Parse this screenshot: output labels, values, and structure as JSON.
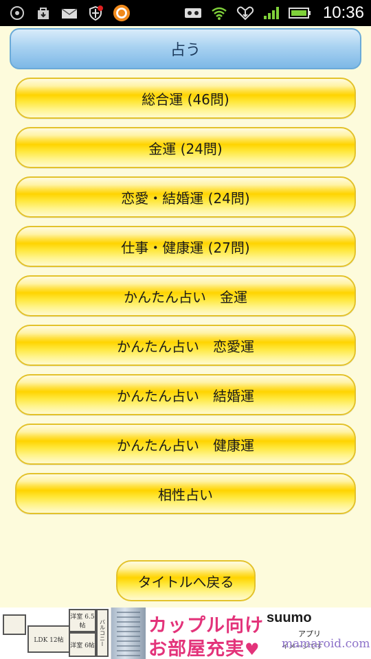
{
  "status_bar": {
    "time": "10:36",
    "left_icons": [
      "aperture-icon",
      "shopping-bag-icon",
      "mail-icon",
      "shield-icon",
      "app-ring-icon"
    ],
    "right_icons": [
      "voicemail-icon",
      "wifi-icon",
      "heart-download-icon",
      "signal-icon",
      "battery-icon"
    ]
  },
  "header": {
    "title": "占う"
  },
  "menu": {
    "items": [
      {
        "label": "総合運 (46問)"
      },
      {
        "label": "金運 (24問)"
      },
      {
        "label": "恋愛・結婚運 (24問)"
      },
      {
        "label": "仕事・健康運 (27問)"
      },
      {
        "label": "かんたん占い　金運"
      },
      {
        "label": "かんたん占い　恋愛運"
      },
      {
        "label": "かんたん占い　結婚運"
      },
      {
        "label": "かんたん占い　健康運"
      },
      {
        "label": "相性占い"
      }
    ]
  },
  "back_button": {
    "label": "タイトルへ戻る"
  },
  "ad": {
    "line1": "カップル向け",
    "line2": "お部屋充実",
    "brand": "suumo",
    "brand_sub": "アプリ",
    "note": "イメージです",
    "rooms": [
      "洋室 6.5帖",
      "LDK 12帖",
      "洋室 6帖",
      "バルコニー"
    ]
  },
  "watermark": "mamaroid.com",
  "colors": {
    "background": "#fdfbdc",
    "header_blue": "#a9d2f1",
    "button_yellow": "#ffd400",
    "ad_pink": "#e3337a"
  }
}
